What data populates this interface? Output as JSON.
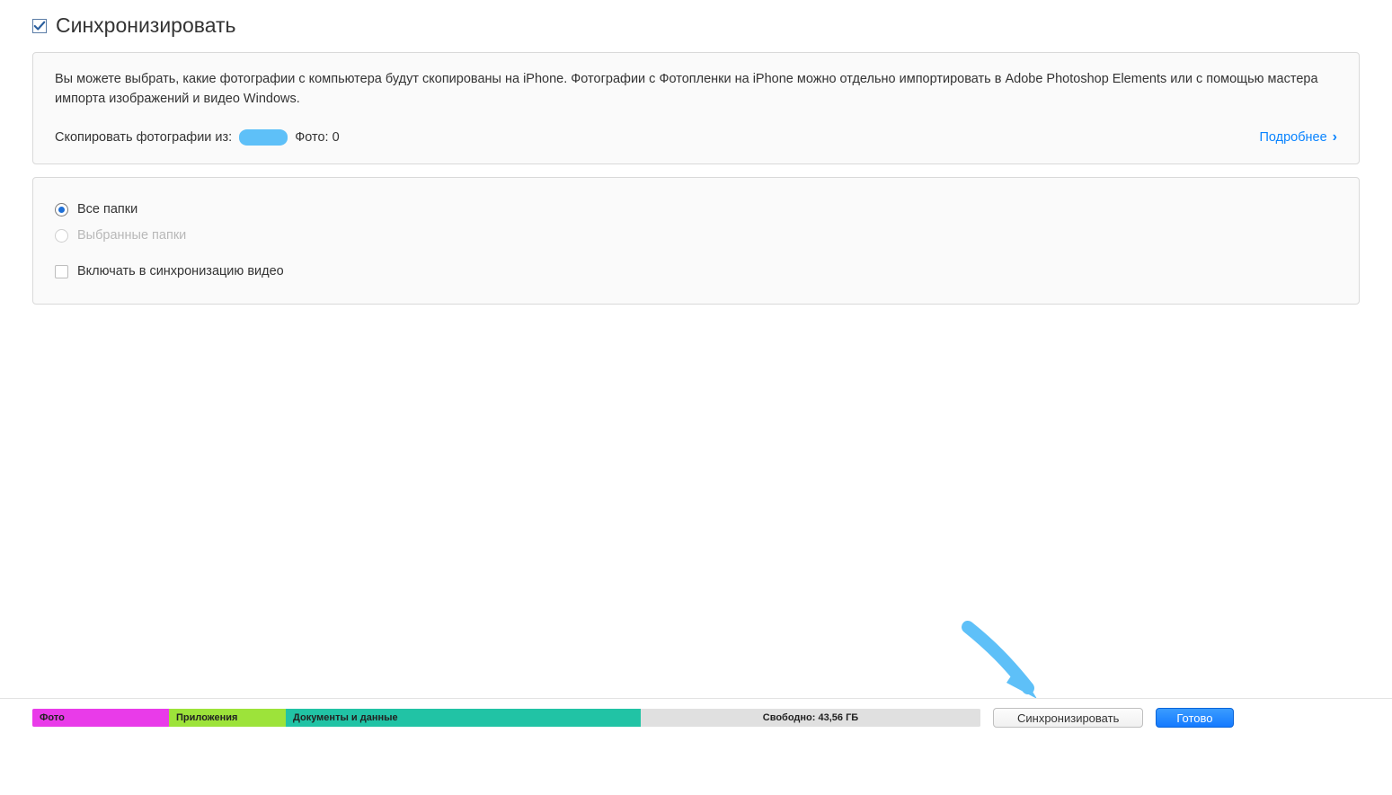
{
  "header": {
    "sync_checkbox_checked": true,
    "title": "Синхронизировать"
  },
  "description_panel": {
    "text": "Вы можете выбрать, какие фотографии с компьютера будут скопированы на iPhone. Фотографии с Фотопленки на iPhone можно отдельно импортировать в Adobe Photoshop Elements или с помощью мастера импорта изображений и видео Windows.",
    "source_label": "Скопировать фотографии из:",
    "photos_label": "Фото: 0",
    "learn_more": "Подробнее"
  },
  "options_panel": {
    "all_folders": "Все папки",
    "selected_folders": "Выбранные папки",
    "include_video": "Включать в синхронизацию видео"
  },
  "storage": {
    "photo": "Фото",
    "apps": "Приложения",
    "docs_data": "Документы и данные",
    "free": "Свободно: 43,56 ГБ"
  },
  "buttons": {
    "sync": "Синхронизировать",
    "done": "Готово"
  },
  "colors": {
    "accent_link": "#0a84ff",
    "arrow": "#5ec0f8",
    "primary_button": "#147aff",
    "seg_photo": "#e93be9",
    "seg_apps": "#9de33a",
    "seg_docs": "#21c3a5"
  }
}
